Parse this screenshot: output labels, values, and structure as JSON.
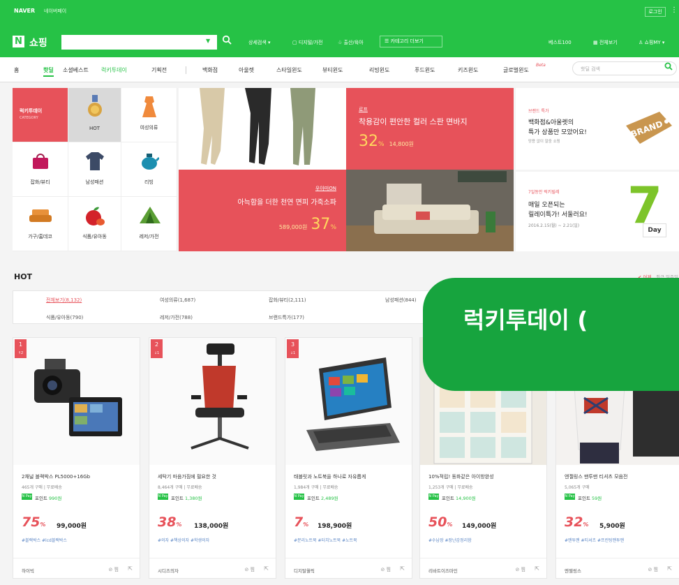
{
  "topbar": {
    "brand": "NAVER",
    "pay_link": "네이버페이",
    "login_label": "로그인",
    "more_icon": "grid-dots-icon"
  },
  "header": {
    "logo_letter": "N",
    "logo_text": "쇼핑",
    "search_placeholder": "",
    "nav": [
      "상세검색 ▾",
      "디지털/가전",
      "출산/육아",
      "카테고리 더보기"
    ],
    "right_links": [
      "베스트100",
      "전체보기",
      "쇼핑MY ▾"
    ]
  },
  "gnb": {
    "items": [
      "홈",
      "핫딜",
      "소셜베스트",
      "럭키투데이",
      "기획전",
      "백화점",
      "아울렛",
      "스타일윈도",
      "뷰티윈도",
      "리빙윈도",
      "푸드윈도",
      "키즈윈도",
      "글로벌윈도"
    ],
    "beta": "Beta",
    "search_placeholder": "핫딜 검색"
  },
  "categories": {
    "header_title": "럭키투데이",
    "header_sub": "CATEGORY",
    "items": [
      "HOT",
      "여성의류",
      "잡화/뷰티",
      "남성패션",
      "리빙",
      "가구/홈데코",
      "식품/유아동",
      "레저/가전"
    ]
  },
  "banners": {
    "pants": {
      "tag": "로프",
      "title": "착용감이 편안한 컬러 스판 면바지",
      "percent": "32",
      "pct_unit": "%",
      "price": "14,800원"
    },
    "sofa": {
      "tag": "우아미ON",
      "title": "아늑함을 더한 천연 면피 가죽소파",
      "price": "589,000원",
      "percent": "37",
      "pct_unit": "%"
    },
    "brand": {
      "tag": "브랜드 특가",
      "line1": "백화점&아울렛의",
      "line2": "특가 상품만 모았어요!",
      "sub": "망용 없이 말중 쇼핑",
      "badge": "BRAND"
    },
    "relay": {
      "tag": "7일동안 럭키릴레",
      "line1": "매일 오픈되는",
      "line2": "릴레이특가! 서둘러요!",
      "date": "2016.2.15(월) ~ 2.21(일)",
      "big": "7",
      "day": "Day"
    }
  },
  "hot": {
    "title": "HOT",
    "sort_active": "✔ 어제",
    "sort_other": "최근 일주일",
    "filters_row1": [
      "전체보기(8,132)",
      "여성의류(1,687)",
      "잡화/뷰티(2,111)",
      "남성패션(844)"
    ],
    "filters_row2": [
      "식품/유아동(790)",
      "레저/가전(788)",
      "브랜드특가(177)"
    ]
  },
  "overlay_text": "럭키투데이 (",
  "products": [
    {
      "rank": "1",
      "rank_change": "↑2",
      "name": "2채널 블랙박스 PL5000+16Gb",
      "sub": "465개 구매 | 무료배송",
      "point": "990원",
      "percent": "75",
      "price": "99,000원",
      "tags": "#블랙박스  #lcd블랙박스",
      "seller": "하이빅"
    },
    {
      "rank": "2",
      "rank_change": "↓1",
      "name": "세탁기 마음가짐에 필요한 것",
      "sub": "8,464개 구매 | 무료배송",
      "point": "1,380원",
      "percent": "38",
      "price": "138,000원",
      "tags": "#의자  #책상의자  #학생의자",
      "seller": "시디즈의자"
    },
    {
      "rank": "3",
      "rank_change": "↓1",
      "name": "태블릿과 노트북을 하나로 자유롭게",
      "sub": "1,984개 구매 | 무료배송",
      "point": "2,489원",
      "percent": "7",
      "price": "198,900원",
      "tags": "#분리노트북  #터치노트북  #노트북",
      "seller": "디지탈월릭"
    },
    {
      "rank": "",
      "rank_change": "",
      "name": "10%적립! 동화같은 아이방완성",
      "sub": "1,253개 구매 | 무료배송",
      "point": "14,900원",
      "percent": "50",
      "price": "149,000원",
      "tags": "#수납장  #장난감정리함",
      "seller": "리바트이즈마인"
    },
    {
      "rank": "",
      "rank_change": "",
      "name": "엔젤링스 맨투맨 티셔츠 모음전",
      "sub": "5,065개 구매",
      "point": "59원",
      "percent": "32",
      "price": "5,900원",
      "tags": "#맨투맨  #티셔츠  #프린팅맨투맨",
      "seller": "엔젤링스"
    }
  ],
  "card_labels": {
    "point_prefix": "포인트",
    "npay": "N Pay",
    "zzim": "찜",
    "pct_unit": "%"
  },
  "colors": {
    "brand_green": "#26c246",
    "accent_red": "#e7525a",
    "overlay_green": "#17a43e"
  }
}
